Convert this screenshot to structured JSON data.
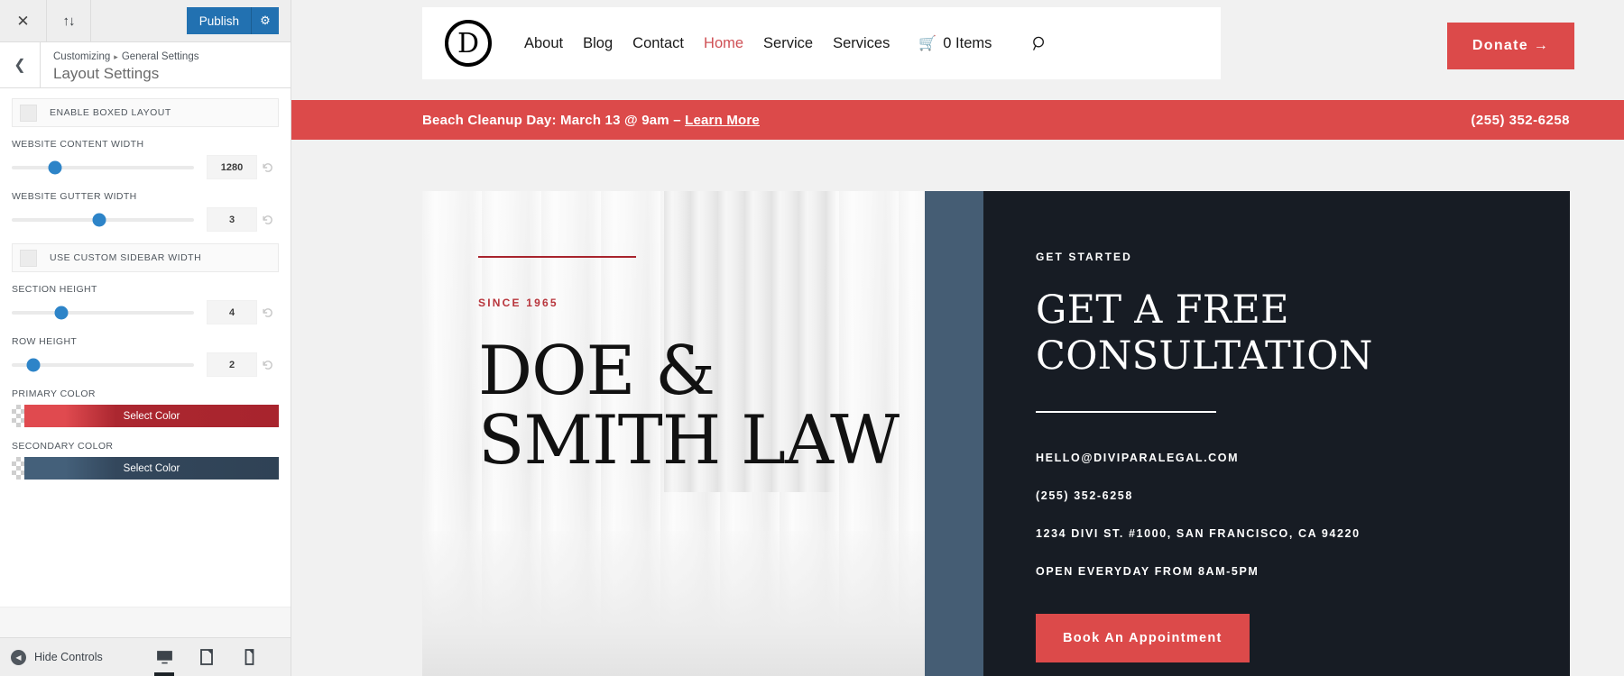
{
  "customizer": {
    "topbar": {
      "close_icon": "close-icon",
      "reorder_icon": "sort-arrows-icon",
      "publish_label": "Publish",
      "gear_icon": "gear-icon"
    },
    "header": {
      "back_icon": "chevron-left-icon",
      "breadcrumb_root": "Customizing",
      "breadcrumb_sep": "▸",
      "breadcrumb_section": "General Settings",
      "panel_title": "Layout Settings"
    },
    "controls": [
      {
        "type": "checkbox",
        "label": "Enable Boxed Layout",
        "checked": false
      },
      {
        "type": "slider",
        "label": "Website Content Width",
        "value": "1280",
        "knob_pct": 24
      },
      {
        "type": "slider",
        "label": "Website Gutter Width",
        "value": "3",
        "knob_pct": 48
      },
      {
        "type": "checkbox",
        "label": "Use Custom Sidebar Width",
        "checked": false
      },
      {
        "type": "slider",
        "label": "Section Height",
        "value": "4",
        "knob_pct": 27
      },
      {
        "type": "slider",
        "label": "Row Height",
        "value": "2",
        "knob_pct": 12
      },
      {
        "type": "color",
        "label": "Primary Color",
        "button_label": "Select Color",
        "swatch": "#a8242d"
      },
      {
        "type": "color",
        "label": "Secondary Color",
        "button_label": "Select Color",
        "swatch": "#33475c"
      }
    ],
    "footer": {
      "hide_controls_label": "Hide Controls",
      "hide_icon": "chevron-left-circle-icon",
      "devices": [
        {
          "name": "desktop",
          "icon": "desktop-icon",
          "active": true
        },
        {
          "name": "tablet",
          "icon": "tablet-icon",
          "active": false
        },
        {
          "name": "mobile",
          "icon": "mobile-icon",
          "active": false
        }
      ]
    }
  },
  "preview": {
    "nav": {
      "logo_letter": "D",
      "links": [
        {
          "label": "About",
          "active": false
        },
        {
          "label": "Blog",
          "active": false
        },
        {
          "label": "Contact",
          "active": false
        },
        {
          "label": "Home",
          "active": true
        },
        {
          "label": "Service",
          "active": false
        },
        {
          "label": "Services",
          "active": false
        }
      ],
      "cart_icon": "shopping-cart-icon",
      "cart_label": "0 Items",
      "search_icon": "search-icon",
      "donate_label": "Donate →"
    },
    "alert": {
      "text_before": "Beach Cleanup Day: March 13 @ 9am – ",
      "link_label": "Learn More",
      "phone": "(255) 352-6258"
    },
    "hero": {
      "eyebrow": "SINCE 1965",
      "title_line1": "DOE &",
      "title_line2": "SMITH LAW"
    },
    "card": {
      "eyebrow": "GET STARTED",
      "heading_line1": "GET A FREE",
      "heading_line2": "CONSULTATION",
      "details": [
        "HELLO@DIVIPARALEGAL.COM",
        "(255) 352-6258",
        "1234 DIVI ST. #1000, SAN FRANCISCO, CA 94220",
        "OPEN EVERYDAY FROM 8AM-5PM"
      ],
      "cta_label": "Book An Appointment"
    }
  },
  "colors": {
    "accent_red": "#dc4a4a",
    "deep_red": "#a8242d",
    "slate": "#455d74",
    "dark_navy": "#171c24",
    "publish_blue": "#2271b1",
    "slider_blue": "#2d84c8"
  }
}
